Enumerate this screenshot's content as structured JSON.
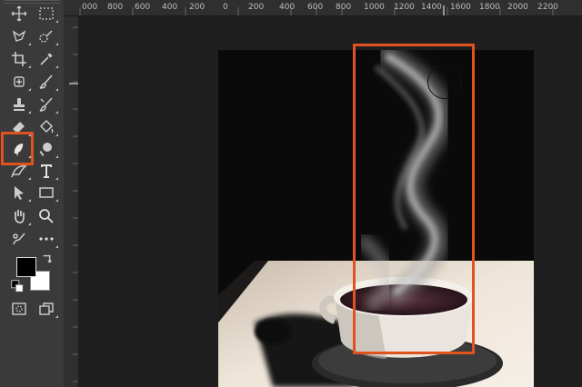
{
  "ruler": {
    "labels": [
      "000",
      "800",
      "600",
      "400",
      "200",
      "0",
      "200",
      "400",
      "600",
      "800",
      "1000",
      "1200",
      "1400",
      "1600",
      "1800",
      "2000",
      "2200"
    ]
  },
  "toolbar": {
    "tools": [
      [
        "move-tool",
        "marquee-tool"
      ],
      [
        "lasso-tool",
        "quick-selection-tool"
      ],
      [
        "crop-tool",
        "eyedropper-tool"
      ],
      [
        "spot-healing-brush-tool",
        "brush-tool"
      ],
      [
        "clone-stamp-tool",
        "history-brush-tool"
      ],
      [
        "eraser-tool",
        "paint-bucket-tool"
      ],
      [
        "smudge-tool",
        "dodge-tool"
      ],
      [
        "pen-tool",
        "type-tool"
      ],
      [
        "path-selection-tool",
        "rectangle-tool"
      ],
      [
        "hand-tool",
        "zoom-tool"
      ],
      [
        "edit-toolbar-icon",
        "more-tools-icon"
      ]
    ],
    "selected_tool": "smudge-tool",
    "foreground_color": "#000000",
    "background_color": "#ffffff",
    "bottom": [
      "quick-mask-mode",
      "screen-mode"
    ]
  },
  "colors": {
    "highlight": "#e0531f",
    "panel": "#3a3a3a",
    "canvas_bg": "#1f1f1f"
  },
  "document": {
    "subject": "coffee cup with rising steam"
  }
}
